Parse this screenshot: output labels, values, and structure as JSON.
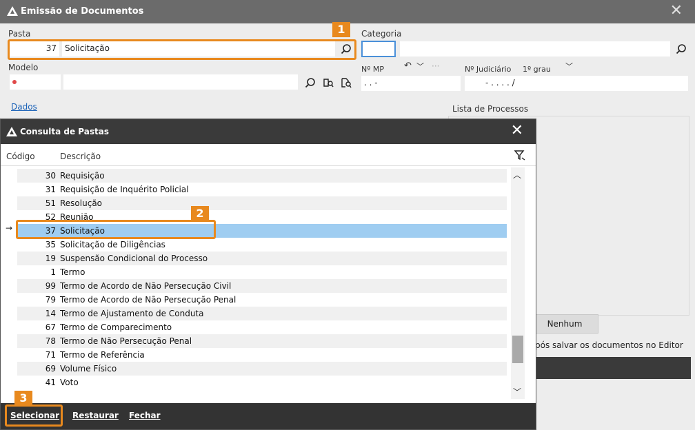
{
  "window": {
    "title": "Emissão de Documentos"
  },
  "pasta": {
    "label": "Pasta",
    "code": "37",
    "name": "Solicitação"
  },
  "categoria": {
    "label": "Categoria"
  },
  "modelo": {
    "label": "Modelo"
  },
  "nmp": {
    "label": "Nº MP",
    "value": ".   .        -"
  },
  "judiciario": {
    "label": "Nº Judiciário",
    "grau": "1º grau",
    "value": "-  .   .  .  .   /"
  },
  "tab": {
    "dados": "Dados"
  },
  "lista": {
    "label": "Lista de Processos",
    "nenhum": "Nenhum",
    "note": "pós salvar os documentos no Editor"
  },
  "dialog": {
    "title": "Consulta de Pastas",
    "col_codigo": "Código",
    "col_descricao": "Descrição",
    "rows": [
      {
        "code": "30",
        "desc": "Requisição"
      },
      {
        "code": "31",
        "desc": "Requisição de Inquérito Policial"
      },
      {
        "code": "51",
        "desc": "Resolução"
      },
      {
        "code": "52",
        "desc": "Reunião"
      },
      {
        "code": "37",
        "desc": "Solicitação"
      },
      {
        "code": "35",
        "desc": "Solicitação de Diligências"
      },
      {
        "code": "19",
        "desc": "Suspensão Condicional do Processo"
      },
      {
        "code": "1",
        "desc": "Termo"
      },
      {
        "code": "99",
        "desc": "Termo de Acordo de Não Persecução Civil"
      },
      {
        "code": "79",
        "desc": "Termo de Acordo de Não Persecução Penal"
      },
      {
        "code": "14",
        "desc": "Termo de Ajustamento de Conduta"
      },
      {
        "code": "67",
        "desc": "Termo de Comparecimento"
      },
      {
        "code": "78",
        "desc": "Termo de Não Persecução Penal"
      },
      {
        "code": "71",
        "desc": "Termo de Referência"
      },
      {
        "code": "69",
        "desc": "Volume Físico"
      },
      {
        "code": "41",
        "desc": "Voto"
      }
    ],
    "selecionar": "Selecionar",
    "restaurar": "Restaurar",
    "fechar": "Fechar"
  },
  "badges": {
    "b1": "1",
    "b2": "2",
    "b3": "3"
  },
  "colors": {
    "accent": "#e8891e",
    "selected_row": "#9fcdf1",
    "titlebar": "#6b6b6b",
    "dialog_titlebar": "#3a3a3a"
  }
}
